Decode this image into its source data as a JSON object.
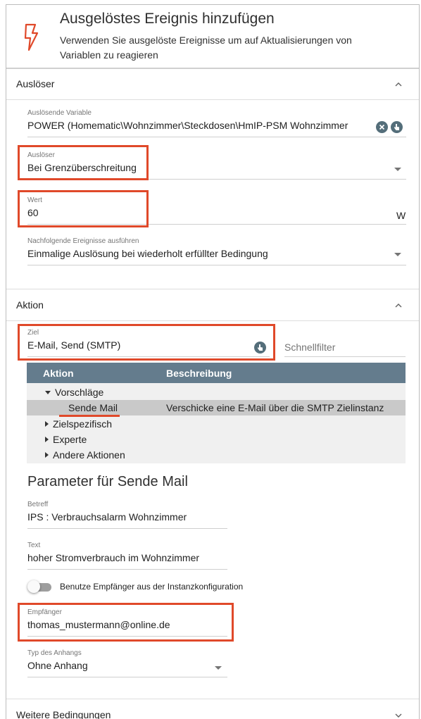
{
  "header": {
    "title": "Ausgelöstes Ereignis hinzufügen",
    "description": "Verwenden Sie ausgelöste Ereignisse um auf Aktualisierungen von Variablen zu reagieren",
    "icon": "lightning-bolt-icon",
    "icon_color": "#e0492a"
  },
  "sections": {
    "trigger": {
      "title": "Auslöser",
      "expanded": true
    },
    "action": {
      "title": "Aktion",
      "expanded": true
    },
    "more_conditions": {
      "title": "Weitere Bedingungen",
      "expanded": false
    }
  },
  "trigger": {
    "variable": {
      "label": "Auslösende Variable",
      "value": "POWER (Homematic\\Wohnzimmer\\Steckdosen\\HmIP-PSM Wohnzimmer"
    },
    "type": {
      "label": "Auslöser",
      "value": "Bei Grenzüberschreitung"
    },
    "value": {
      "label": "Wert",
      "value": "60",
      "unit": "W"
    },
    "subsequent": {
      "label": "Nachfolgende Ereignisse ausführen",
      "value": "Einmalige Auslösung bei wiederholt erfüllter Bedingung"
    }
  },
  "action": {
    "target": {
      "label": "Ziel",
      "value": "E-Mail, Send (SMTP)"
    },
    "quickfilter": {
      "placeholder": "Schnellfilter"
    },
    "table": {
      "columns": [
        "Aktion",
        "Beschreibung"
      ],
      "rows": [
        {
          "name": "Vorschläge",
          "expanded": true
        },
        {
          "name": "Sende Mail",
          "description": "Verschicke eine E-Mail über die SMTP Zielinstanz",
          "selected": true
        },
        {
          "name": "Zielspezifisch",
          "expanded": false
        },
        {
          "name": "Experte",
          "expanded": false
        },
        {
          "name": "Andere Aktionen",
          "expanded": false
        }
      ]
    }
  },
  "params": {
    "title": "Parameter für Sende Mail",
    "subject": {
      "label": "Betreff",
      "value": "IPS : Verbrauchsalarm Wohnzimmer"
    },
    "text": {
      "label": "Text",
      "value": "hoher Stromverbrauch im Wohnzimmer"
    },
    "use_instance_recipient": {
      "label": "Benutze Empfänger aus der Instanzkonfiguration",
      "checked": false
    },
    "recipient": {
      "label": "Empfänger",
      "value": "thomas_mustermann@online.de"
    },
    "attachment": {
      "label": "Typ des Anhangs",
      "value": "Ohne Anhang"
    }
  },
  "colors": {
    "highlight": "#e0492a",
    "table_header": "#647c8d",
    "selected_row": "#c9c9c9"
  }
}
